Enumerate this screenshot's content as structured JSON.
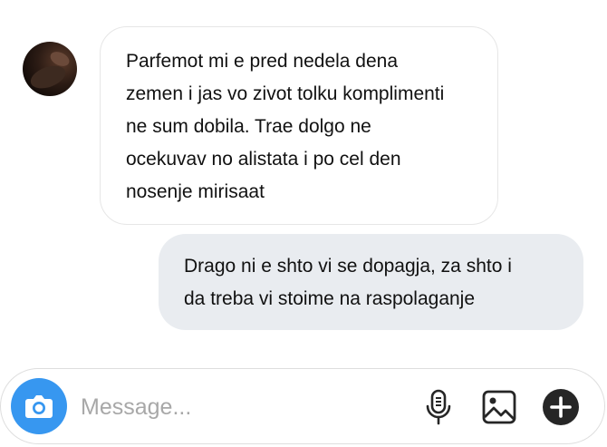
{
  "conversation": {
    "messages": [
      {
        "direction": "incoming",
        "lines": [
          "Parfemot mi e pred nedela dena",
          "zemen i jas vo zivot tolku komplimenti",
          "ne sum dobila. Trae dolgo ne",
          "ocekuvav no alistata i po cel den",
          "nosenje mirisaat"
        ]
      },
      {
        "direction": "outgoing",
        "lines": [
          "Drago ni e shto vi se dopagja, za shto i",
          "da treba vi stoime na raspolaganje"
        ]
      }
    ]
  },
  "composer": {
    "placeholder": "Message...",
    "value": "",
    "icons": {
      "camera": "camera-icon",
      "microphone": "microphone-icon",
      "gallery": "image-icon",
      "add": "plus-circle-icon"
    }
  },
  "colors": {
    "accent": "#3797f0",
    "outgoing_bubble": "#e9ecf0",
    "incoming_border": "#e6e6e6",
    "text": "#111111",
    "placeholder": "#a8a8a8"
  }
}
